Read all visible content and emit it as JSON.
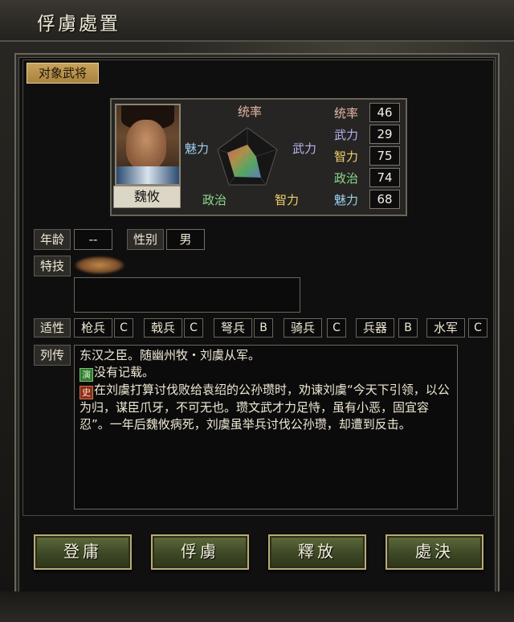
{
  "window": {
    "title": "俘虜處置"
  },
  "target_tag": "对象武将",
  "officer": {
    "name": "魏攸",
    "stats": [
      {
        "label": "统率",
        "value": "46",
        "color": "#e8b6a5"
      },
      {
        "label": "武力",
        "value": "29",
        "color": "#b8b2ef"
      },
      {
        "label": "智力",
        "value": "75",
        "color": "#f2d26a"
      },
      {
        "label": "政治",
        "value": "74",
        "color": "#8fd98c"
      },
      {
        "label": "魅力",
        "value": "68",
        "color": "#9fd0f2"
      }
    ],
    "radar_labels": {
      "top": "统率",
      "right": "武力",
      "bottom_right": "智力",
      "bottom_left": "政治",
      "left": "魅力"
    }
  },
  "info": {
    "age_label": "年龄",
    "age_value": "--",
    "gender_label": "性别",
    "gender_value": "男",
    "skill_label": "特技",
    "aptitude_label": "适性",
    "aptitudes": [
      {
        "name": "枪兵",
        "grade": "C"
      },
      {
        "name": "戟兵",
        "grade": "C"
      },
      {
        "name": "弩兵",
        "grade": "B"
      },
      {
        "name": "骑兵",
        "grade": "C"
      },
      {
        "name": "兵器",
        "grade": "B"
      },
      {
        "name": "水军",
        "grade": "C"
      }
    ],
    "bio_label": "列传",
    "bio": {
      "line1": "东汉之臣。随幽州牧・刘虞从军。",
      "yan_icon": "演",
      "yan_text": "没有记载。",
      "shi_icon": "史",
      "shi_text": "在刘虞打算讨伐败给袁绍的公孙瓒时，劝谏刘虞“今天下引领，以公为归，谋臣爪牙，不可无也。瓒文武才力足恃，虽有小恶，固宜容忍”。一年后魏攸病死，刘虞虽举兵讨伐公孙瓒，却遭到反击。"
    }
  },
  "buttons": {
    "recruit": "登庸",
    "capture": "俘虜",
    "release": "釋放",
    "execute": "處決"
  }
}
